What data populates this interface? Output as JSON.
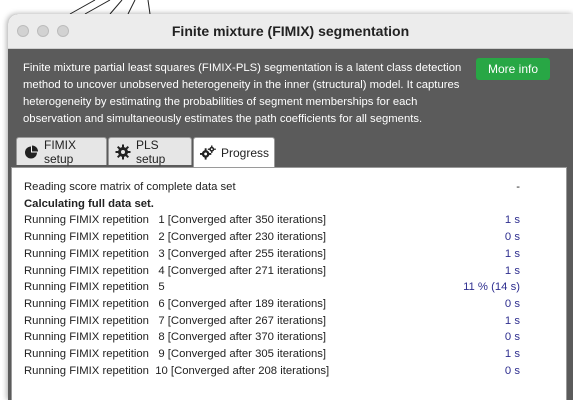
{
  "window": {
    "title": "Finite mixture (FIMIX) segmentation"
  },
  "description": "Finite mixture partial least squares (FIMIX-PLS) segmentation is a latent class detection method to uncover unobserved heterogeneity in the inner (structural) model. It captures heterogeneity by estimating the probabilities of segment memberships for each observation and simultaneously estimates the path coefficients for all segments.",
  "more_info_label": "More info",
  "tabs": [
    {
      "label": "FIMIX setup",
      "icon": "pie-chart-icon"
    },
    {
      "label": "PLS setup",
      "icon": "gear-icon"
    },
    {
      "label": "Progress",
      "icon": "gears-icon",
      "active": true
    }
  ],
  "progress": [
    {
      "label": "Reading score matrix of complete data set",
      "value": "-"
    },
    {
      "label": "Calculating full data set.",
      "value": "",
      "bold": true
    },
    {
      "label": "Running FIMIX repetition   1 [Converged after 350 iterations]",
      "value": "1 s"
    },
    {
      "label": "Running FIMIX repetition   2 [Converged after 230 iterations]",
      "value": "0 s"
    },
    {
      "label": "Running FIMIX repetition   3 [Converged after 255 iterations]",
      "value": "1 s"
    },
    {
      "label": "Running FIMIX repetition   4 [Converged after 271 iterations]",
      "value": "1 s"
    },
    {
      "label": "Running FIMIX repetition   5",
      "value": "11 % (14 s)"
    },
    {
      "label": "Running FIMIX repetition   6 [Converged after 189 iterations]",
      "value": "0 s"
    },
    {
      "label": "Running FIMIX repetition   7 [Converged after 267 iterations]",
      "value": "1 s"
    },
    {
      "label": "Running FIMIX repetition   8 [Converged after 370 iterations]",
      "value": "0 s"
    },
    {
      "label": "Running FIMIX repetition   9 [Converged after 305 iterations]",
      "value": "1 s"
    },
    {
      "label": "Running FIMIX repetition  10 [Converged after 208 iterations]",
      "value": "0 s"
    }
  ]
}
